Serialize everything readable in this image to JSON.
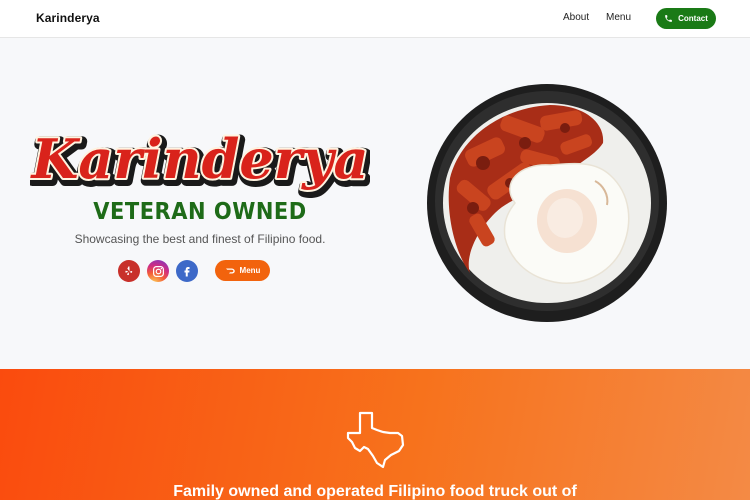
{
  "header": {
    "brand": "Karinderya",
    "nav": {
      "about": "About",
      "menu": "Menu"
    },
    "contact_label": "Contact"
  },
  "hero": {
    "logo_text": "Karinderya",
    "badge": "VETERAN OWNED",
    "tagline": "Showcasing the best and finest of Filipino food.",
    "menu_button_label": "Menu",
    "social": [
      "yelp-icon",
      "instagram-icon",
      "facebook-icon"
    ]
  },
  "section2": {
    "icon": "texas-outline-icon",
    "heading": "Family owned and operated Filipino food truck out of"
  },
  "colors": {
    "nav_green": "#1a7a16",
    "badge_green": "#1e6b18",
    "accent_orange": "#f2630d",
    "logo_red": "#d9231b",
    "banner_orange": "#fa4b0e"
  }
}
